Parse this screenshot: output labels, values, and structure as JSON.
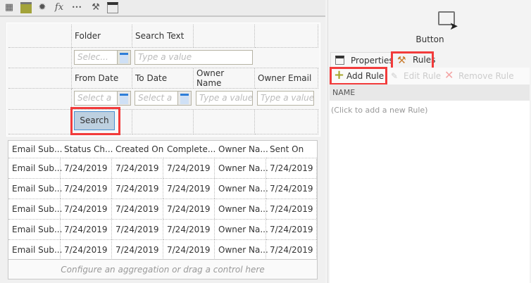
{
  "toolbar": {
    "icons": [
      "table-icon",
      "picture-icon",
      "gear-icon",
      "fx-icon",
      "ellipsis-icon",
      "tools-icon",
      "properties-icon"
    ],
    "fx": "fx",
    "dots": "•••"
  },
  "form": {
    "folder_label": "Folder",
    "search_text_label": "Search Text",
    "folder_placeholder": "Selec...",
    "search_text_placeholder": "Type a value",
    "from_date_label": "From Date",
    "to_date_label": "To Date",
    "owner_name_label": "Owner Name",
    "owner_email_label": "Owner Email",
    "from_date_placeholder": "Select a",
    "to_date_placeholder": "Select a",
    "owner_name_placeholder": "Type a value",
    "owner_email_placeholder": "Type a value",
    "search_button": "Search"
  },
  "grid": {
    "headers": [
      "Email Sub...",
      "Status Ch...",
      "Created On",
      "Complete...",
      "Owner Na...",
      "Sent On"
    ],
    "rows": [
      [
        "Email Sub...",
        "7/24/2019",
        "7/24/2019",
        "7/24/2019",
        "Owner Na...",
        "7/24/2019"
      ],
      [
        "Email Sub...",
        "7/24/2019",
        "7/24/2019",
        "7/24/2019",
        "Owner Na...",
        "7/24/2019"
      ],
      [
        "Email Sub...",
        "7/24/2019",
        "7/24/2019",
        "7/24/2019",
        "Owner Na...",
        "7/24/2019"
      ],
      [
        "Email Sub...",
        "7/24/2019",
        "7/24/2019",
        "7/24/2019",
        "Owner Na...",
        "7/24/2019"
      ],
      [
        "Email Sub...",
        "7/24/2019",
        "7/24/2019",
        "7/24/2019",
        "Owner Na...",
        "7/24/2019"
      ]
    ],
    "footer": "Configure an aggregation or drag a control here"
  },
  "panel": {
    "control_name": "Button",
    "tabs": [
      {
        "label": "Properties"
      },
      {
        "label": "Rules",
        "active": true
      }
    ],
    "add_rule": "Add Rule",
    "edit_rule": "Edit Rule",
    "remove_rule": "Remove Rule",
    "column_header": "NAME",
    "empty_text": "(Click to add a new Rule)"
  },
  "colors": {
    "highlight": "#f23b3b",
    "button_bg": "#bdd0e0",
    "add_icon": "#a6a62a",
    "remove_icon": "#f3a5a5",
    "rules_icon": "#c97a2b"
  }
}
